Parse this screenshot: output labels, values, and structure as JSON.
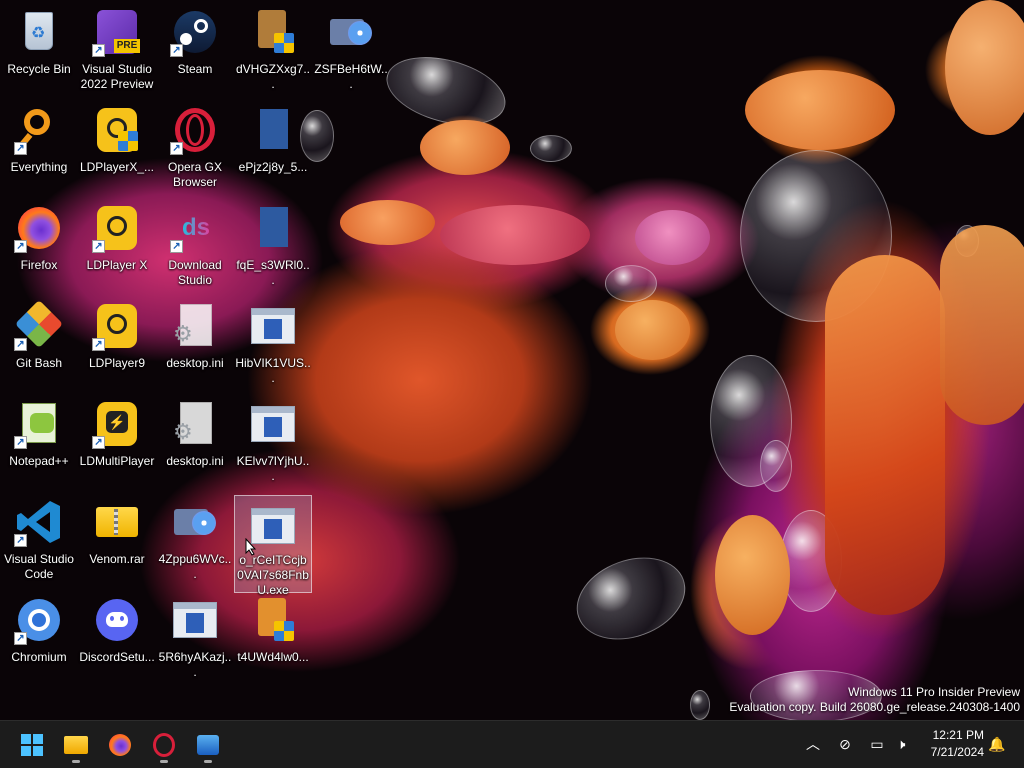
{
  "desktop_icons": {
    "recycle_bin": "Recycle Bin",
    "visual_studio_preview": "Visual Studio 2022 Preview",
    "steam": "Steam",
    "dvhgz": "dVHGZXxg7...",
    "zsfbeh": "ZSFBeH6tW...",
    "everything": "Everything",
    "ldplayerx_underscore": "LDPlayerX_...",
    "opera_gx": "Opera GX Browser",
    "epjz": "ePjz2j8y_5...",
    "firefox": "Firefox",
    "ldplayer_x": "LDPlayer X",
    "download_studio": "Download Studio",
    "fqe": "fqE_s3WRl0...",
    "git_bash": "Git Bash",
    "ldplayer9": "LDPlayer9",
    "desktop_ini_1": "desktop.ini",
    "hibvik": "HibVIK1VUS...",
    "notepadpp": "Notepad++",
    "ldmultiplayer": "LDMultiPlayer",
    "desktop_ini_2": "desktop.ini",
    "kelvv": "KElvv7lYjhU...",
    "vscode": "Visual Studio Code",
    "venom_rar": "Venom.rar",
    "4zppu": "4Zppu6WVc...",
    "selected_exe": "o_rCeITCcjb0VAI7s68FnbU.exe",
    "chromium": "Chromium",
    "discord_setup": "DiscordSetu...",
    "5r6hy": "5R6hyAKazj...",
    "t4uwd": "t4UWd4lw0..."
  },
  "watermark": {
    "line1": "Windows 11 Pro Insider Preview",
    "line2": "Evaluation copy. Build 26080.ge_release.240308-1400"
  },
  "taskbar": {
    "pinned": [
      "start-icon",
      "file-explorer-icon",
      "firefox-icon",
      "opera-gx-icon",
      "photos-icon"
    ],
    "tray": [
      "chevron-up-icon",
      "network-off-icon",
      "display-icon",
      "volume-muted-icon",
      "notification-bell-icon"
    ],
    "time": "12:21 PM",
    "date": "7/21/2024"
  },
  "colors": {
    "taskbar_bg": "#1c1c1c",
    "accent_blue": "#2f7dd6",
    "notification_badge": "#e8643c"
  }
}
